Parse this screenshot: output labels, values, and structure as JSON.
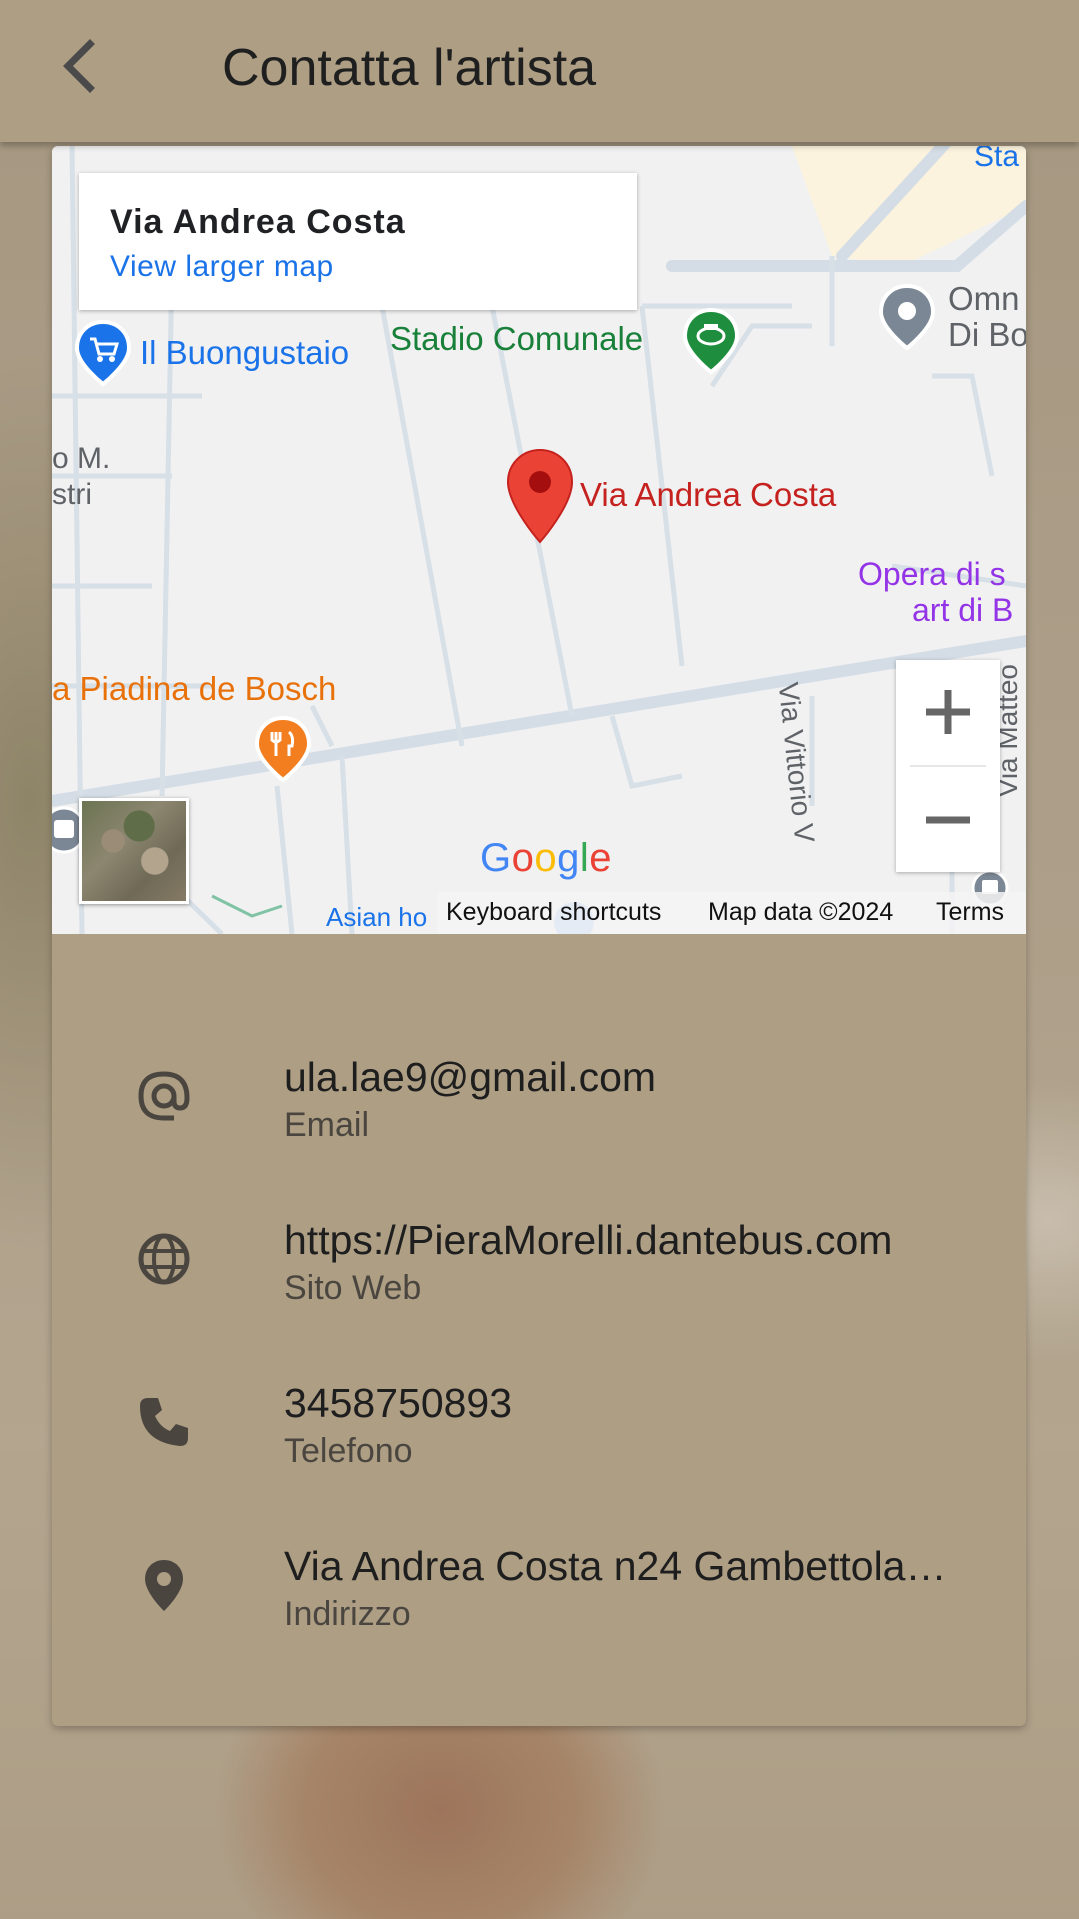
{
  "app_bar": {
    "title": "Contatta l'artista",
    "back_icon": "chevron-left-icon"
  },
  "map": {
    "place_name": "Via Andrea Costa",
    "view_larger": "View larger map",
    "pin_label": "Via Andrea Costa",
    "poi": [
      {
        "name": "Il Buongustaio",
        "color": "#1a73e8"
      },
      {
        "name": "Stadio Comunale",
        "color": "#188038"
      },
      {
        "name": "Omn",
        "color": "#5f6368"
      },
      {
        "name": "Di Bo",
        "color": "#5f6368"
      },
      {
        "name": "o M.",
        "color": "#5f6368"
      },
      {
        "name": "stri",
        "color": "#5f6368"
      },
      {
        "name": "Opera di s",
        "color": "#9334e6"
      },
      {
        "name": "art di B",
        "color": "#9334e6"
      },
      {
        "name": "a Piadina de Bosch",
        "color": "#e8710a"
      },
      {
        "name": "Asian ho",
        "color": "#1a73e8"
      },
      {
        "name": "Sta",
        "color": "#1a73e8"
      }
    ],
    "streets": [
      "Via Vittorio V",
      "Via Matteo"
    ],
    "zoom_in": "+",
    "zoom_out": "−",
    "google_logo": [
      "G",
      "o",
      "o",
      "g",
      "l",
      "e"
    ],
    "footer": {
      "shortcuts": "Keyboard shortcuts",
      "map_data": "Map data ©2024",
      "terms": "Terms"
    }
  },
  "contacts": [
    {
      "value": "ula.lae9@gmail.com",
      "label": "Email",
      "icon": "at-icon"
    },
    {
      "value": "https://PieraMorelli.dantebus.com",
      "label": "Sito Web",
      "icon": "globe-icon"
    },
    {
      "value": "3458750893",
      "label": "Telefono",
      "icon": "phone-icon"
    },
    {
      "value": "Via Andrea Costa n24 Gambettola…",
      "label": "Indirizzo",
      "icon": "location-pin-icon"
    }
  ]
}
